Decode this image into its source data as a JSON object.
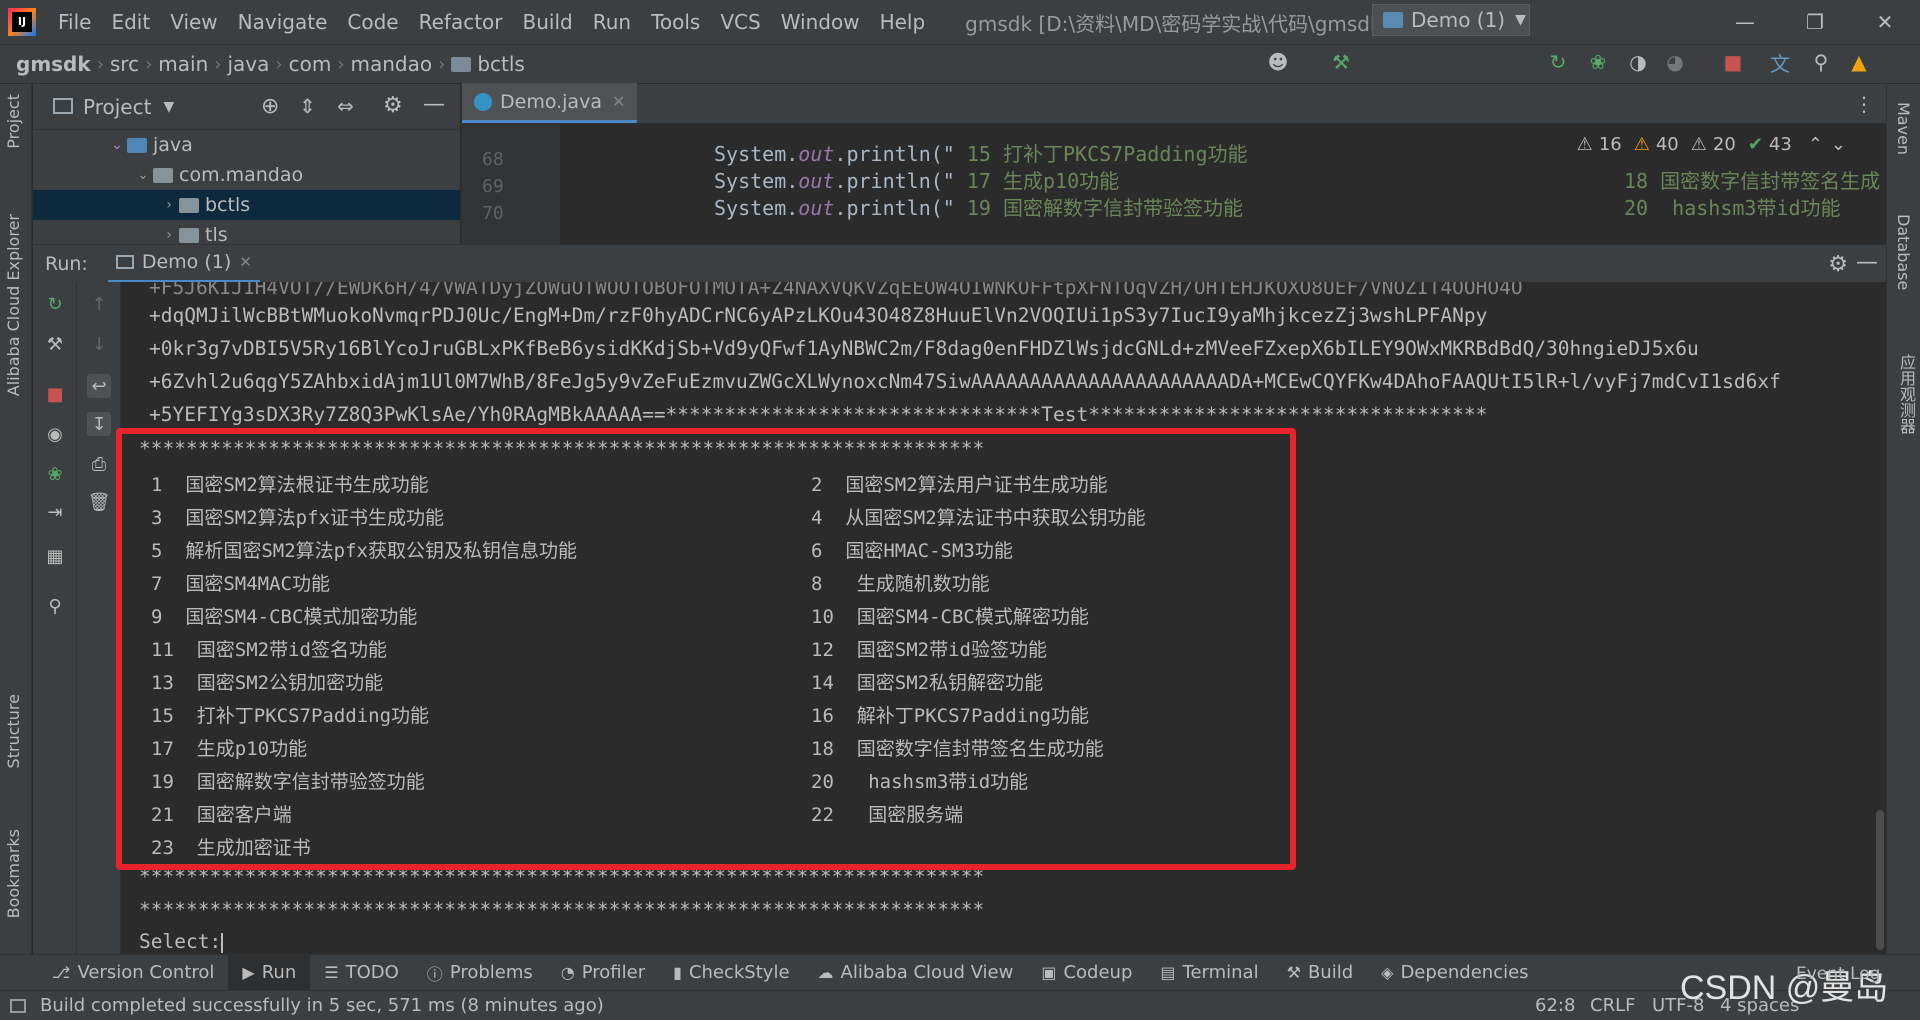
{
  "menu": [
    "File",
    "Edit",
    "View",
    "Navigate",
    "Code",
    "Refactor",
    "Build",
    "Run",
    "Tools",
    "VCS",
    "Window",
    "Help"
  ],
  "window_title": "gmsdk [D:\\资料\\MD\\密码学实战\\代码\\gmsdk] - Demo.java",
  "breadcrumbs": [
    "gmsdk",
    "src",
    "main",
    "java",
    "com",
    "mandao",
    "bctls"
  ],
  "run_config": "Demo (1)",
  "left_tabs": [
    "Project",
    "Alibaba Cloud Explorer",
    "Structure",
    "Bookmarks"
  ],
  "right_tabs": [
    "Maven",
    "Database",
    "应用观测器"
  ],
  "project": {
    "title": "Project",
    "tree": [
      {
        "label": "java",
        "indent": 1,
        "expanded": true,
        "selected": false
      },
      {
        "label": "com.mandao",
        "indent": 2,
        "expanded": true,
        "selected": false
      },
      {
        "label": "bctls",
        "indent": 3,
        "expanded": false,
        "selected": true
      },
      {
        "label": "tls",
        "indent": 3,
        "expanded": false,
        "selected": false
      }
    ]
  },
  "editor": {
    "tab": "Demo.java",
    "lines": [
      {
        "no": "68",
        "pre": "System.",
        "out": "out",
        "post": ".println(\"",
        "str": " 15 打补丁PKCS7Padding功能",
        "right": "18 国密数字信封带签名生成"
      },
      {
        "no": "69",
        "pre": "System.",
        "out": "out",
        "post": ".println(\"",
        "str": " 17 生成p10功能",
        "right": "20  hashsm3带id功能"
      },
      {
        "no": "70",
        "pre": "System.",
        "out": "out",
        "post": ".println(\"",
        "str": " 19 国密解数字信封带验签功能",
        "right": "22  国密服务端"
      }
    ],
    "inspections": {
      "weak_warnings": "16",
      "warnings": "40",
      "typos": "20",
      "ok": "43"
    }
  },
  "run": {
    "label": "Run:",
    "tab": "Demo (1)",
    "console_lines": [
      "+dqQMJilWcBBtWMuokoNvmqrPDJ0Uc/EngM+Dm/rzF0hyADCrNC6yAPzLKOu43O48Z8HuuElVn2VOQIUi1pS3y7IucI9yaMhjkcezZj3wshLPFANpy",
      "+0kr3g7vDBI5V5Ry16BlYcoJruGBLxPKfBeB6ysidKKdjSb+Vd9yQFwf1AyNBWC2m/F8dag0enFHDZlWsjdcGNLd+zMVeeFZxepX6bILEY9OWxMKRBdBdQ/30hngieDJ5x6u",
      "+6Zvhl2u6qgY5ZAhbxidAjm1Ul0M7WhB/8FeJg5y9vZeFuEzmvuZWGcXLWynoxcNm47SiwAAAAAAAAAAAAAAAAAAAAAADA+MCEwCQYFKw4DAhoFAAQUtI5lR+l/vyFj7mdCvI1sd6xf",
      "+5YEFIYg3sDX3Ry7Z8Q3PwKlsAe/Yh0RAgMBkAAAAA==********************************Test**********************************"
    ],
    "stars": "************************************************************************",
    "menu_left": [
      "1  国密SM2算法根证书生成功能",
      "3  国密SM2算法pfx证书生成功能",
      "5  解析国密SM2算法pfx获取公钥及私钥信息功能",
      "7  国密SM4MAC功能",
      "9  国密SM4-CBC模式加密功能",
      "11  国密SM2带id签名功能",
      "13  国密SM2公钥加密功能",
      "15  打补丁PKCS7Padding功能",
      "17  生成p10功能",
      "19  国密解数字信封带验签功能",
      "21  国密客户端",
      "23  生成加密证书"
    ],
    "menu_right": [
      "2  国密SM2算法用户证书生成功能",
      "4  从国密SM2算法证书中获取公钥功能",
      "6  国密HMAC-SM3功能",
      "8   生成随机数功能",
      "10  国密SM4-CBC模式解密功能",
      "12  国密SM2带id验签功能",
      "14  国密SM2私钥解密功能",
      "16  解补丁PKCS7Padding功能",
      "18  国密数字信封带签名生成功能",
      "20   hashsm3带id功能",
      "22   国密服务端",
      ""
    ],
    "prompt": "Select:"
  },
  "tool_tabs": [
    {
      "label": "Version Control",
      "icon": "branch-icon"
    },
    {
      "label": "Run",
      "icon": "run-icon"
    },
    {
      "label": "TODO",
      "icon": "list-icon"
    },
    {
      "label": "Problems",
      "icon": "info-icon"
    },
    {
      "label": "Profiler",
      "icon": "profiler-icon"
    },
    {
      "label": "CheckStyle",
      "icon": "checkstyle-icon"
    },
    {
      "label": "Alibaba Cloud View",
      "icon": "cloud-icon"
    },
    {
      "label": "Codeup",
      "icon": "codeup-icon"
    },
    {
      "label": "Terminal",
      "icon": "terminal-icon"
    },
    {
      "label": "Build",
      "icon": "hammer-icon"
    },
    {
      "label": "Dependencies",
      "icon": "layers-icon"
    }
  ],
  "status": {
    "message": "Build completed successfully in 5 sec, 571 ms (8 minutes ago)",
    "position": "62:8",
    "line_sep": "CRLF",
    "encoding": "UTF-8",
    "indent": "4 spaces",
    "event_log": "Event Log"
  },
  "watermark": "CSDN @曼岛",
  "colors": {
    "accent": "#4a88c7",
    "highlight": "#e8232a",
    "string": "#6a8759",
    "field": "#9876aa"
  }
}
